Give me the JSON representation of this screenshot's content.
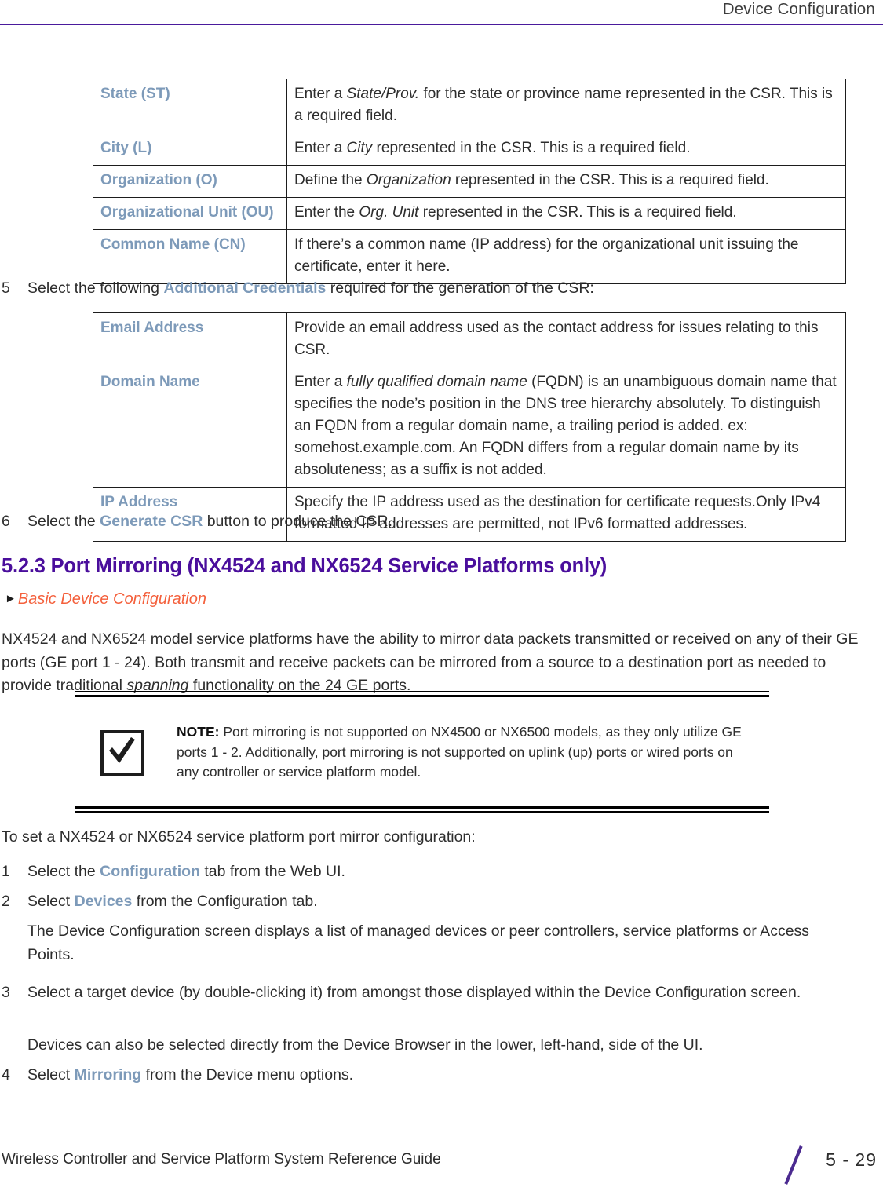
{
  "header": {
    "title": "Device Configuration"
  },
  "csr_table": {
    "rows": [
      {
        "label": "State (ST)",
        "desc_pre": "Enter a ",
        "desc_em": "State/Prov.",
        "desc_post": " for the state or province name represented in the CSR. This is a required field."
      },
      {
        "label": "City (L)",
        "desc_pre": "Enter a ",
        "desc_em": "City",
        "desc_post": " represented in the CSR. This is a required field."
      },
      {
        "label": "Organization (O)",
        "desc_pre": "Define the ",
        "desc_em": "Organization",
        "desc_post": " represented in the CSR. This is a required field."
      },
      {
        "label": "Organizational Unit (OU)",
        "desc_pre": "Enter the ",
        "desc_em": "Org. Unit",
        "desc_post": " represented in the CSR. This is a required field."
      },
      {
        "label": "Common Name (CN)",
        "desc_pre": "If there’s a common name (IP address) for the organizational unit issuing the certificate, enter it here.",
        "desc_em": "",
        "desc_post": ""
      }
    ]
  },
  "step5": {
    "num": "5",
    "pre": "Select the following ",
    "term": "Additional Credentials",
    "post": " required for the generation of the CSR:"
  },
  "credentials_table": {
    "rows": [
      {
        "label": "Email Address",
        "desc_pre": "Provide an email address used as the contact address for issues relating to this CSR.",
        "desc_em": "",
        "desc_post": ""
      },
      {
        "label": "Domain Name",
        "desc_pre": "Enter a ",
        "desc_em": "fully qualified domain name",
        "desc_post": " (FQDN) is an unambiguous domain name that specifies the node’s position in the DNS tree hierarchy absolutely. To distinguish an FQDN from a regular domain name, a trailing period is added. ex: somehost.example.com. An FQDN differs from a regular domain name by its absoluteness; as a suffix is not added."
      },
      {
        "label": "IP Address",
        "desc_pre": "Specify the IP address used as the destination for certificate requests.Only IPv4 formatted IP addresses are permitted, not IPv6 formatted addresses.",
        "desc_em": "",
        "desc_post": ""
      }
    ]
  },
  "step6": {
    "num": "6",
    "pre": "Select the ",
    "term": "Generate CSR",
    "post": " button to produce the CSR."
  },
  "section": {
    "heading": "5.2.3 Port Mirroring (NX4524 and NX6524 Service Platforms only)",
    "xref": "Basic Device Configuration",
    "intro_pre": "NX4524 and NX6524 model service platforms have the ability to mirror data packets transmitted or received on any of their GE ports (GE port 1 - 24). Both transmit and receive packets can be mirrored from a source to a destination port as needed to provide traditional ",
    "intro_em": "spanning",
    "intro_post": " functionality on the 24 GE ports."
  },
  "note": {
    "icon": "checkmark-icon",
    "label": "NOTE:",
    "text": " Port mirroring is not supported on NX4500 or NX6500 models, as they only utilize GE ports 1 - 2. Additionally, port mirroring is not supported on uplink (up) ports or wired ports on any controller or service platform model."
  },
  "procedure": {
    "intro": "To set a NX4524 or NX6524 service platform port mirror configuration:",
    "steps": [
      {
        "num": "1",
        "pre": "Select the ",
        "term": "Configuration",
        "post": " tab from the Web UI."
      },
      {
        "num": "2",
        "pre": "Select ",
        "term": "Devices",
        "post": " from the Configuration tab."
      },
      {
        "num": "3",
        "pre": "Select a target device (by double-clicking it) from amongst those displayed within the Device Configuration screen.",
        "term": "",
        "post": ""
      },
      {
        "num": "4",
        "pre": "Select ",
        "term": "Mirroring",
        "post": " from the Device menu options."
      }
    ],
    "note_after_step2": "The Device Configuration screen displays a list of managed devices or peer controllers, service platforms or Access Points.",
    "note_after_step3": "Devices can also be selected directly from the Device Browser in the lower, left-hand, side of the UI."
  },
  "footer": {
    "guide_title": "Wireless Controller and Service Platform System Reference Guide",
    "page_number": "5 - 29"
  },
  "colors": {
    "ui_term_blue": "#7d9ab9",
    "heading_purple": "#4a0e9c",
    "xref_orange": "#f4603c",
    "rule_purple": "#4a1a9c",
    "footer_slash_purple": "#4b2a90"
  }
}
